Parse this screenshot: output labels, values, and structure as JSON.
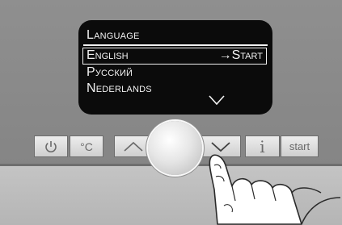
{
  "display": {
    "title": "Language",
    "items": [
      "English",
      "Русский",
      "Nederlands"
    ],
    "selected_index": 0,
    "selected_hint": "→Start",
    "more_indicator": "chevron-down-icon"
  },
  "buttons": {
    "power_icon": "power-icon",
    "temp_label": "°C",
    "up_icon": "chevron-up-icon",
    "down_icon": "chevron-down-icon",
    "info_label": "i",
    "start_label": "start"
  },
  "colors": {
    "panel": "#8c8c8c",
    "display_bg": "#0b0b0b",
    "display_text": "#f2f2f2",
    "button": "#e2e2e2"
  }
}
